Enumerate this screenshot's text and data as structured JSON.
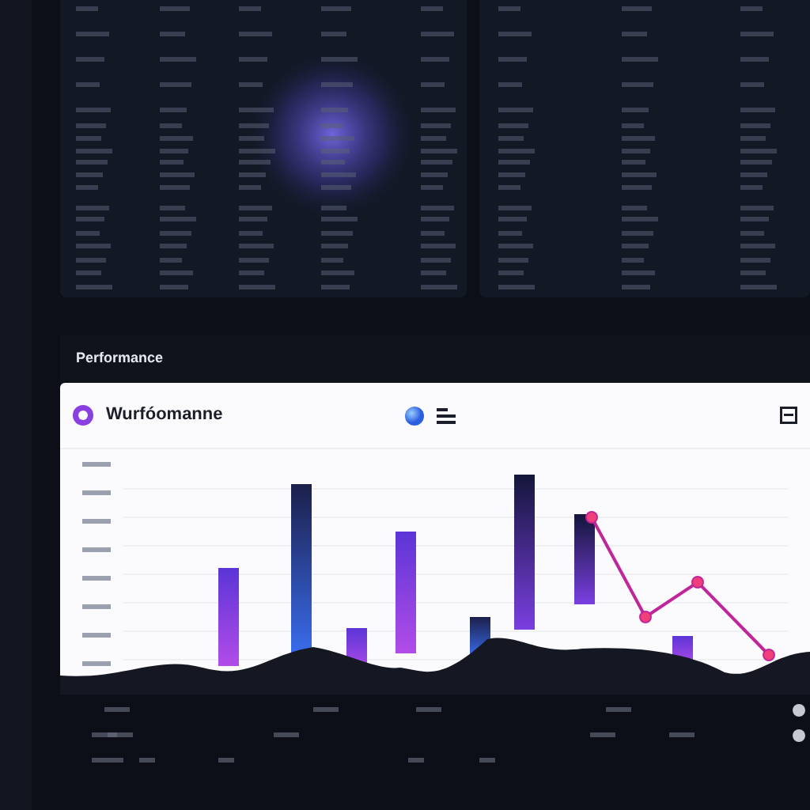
{
  "section": {
    "title": "Performance"
  },
  "card": {
    "title": "Wurfóomanne"
  }
}
